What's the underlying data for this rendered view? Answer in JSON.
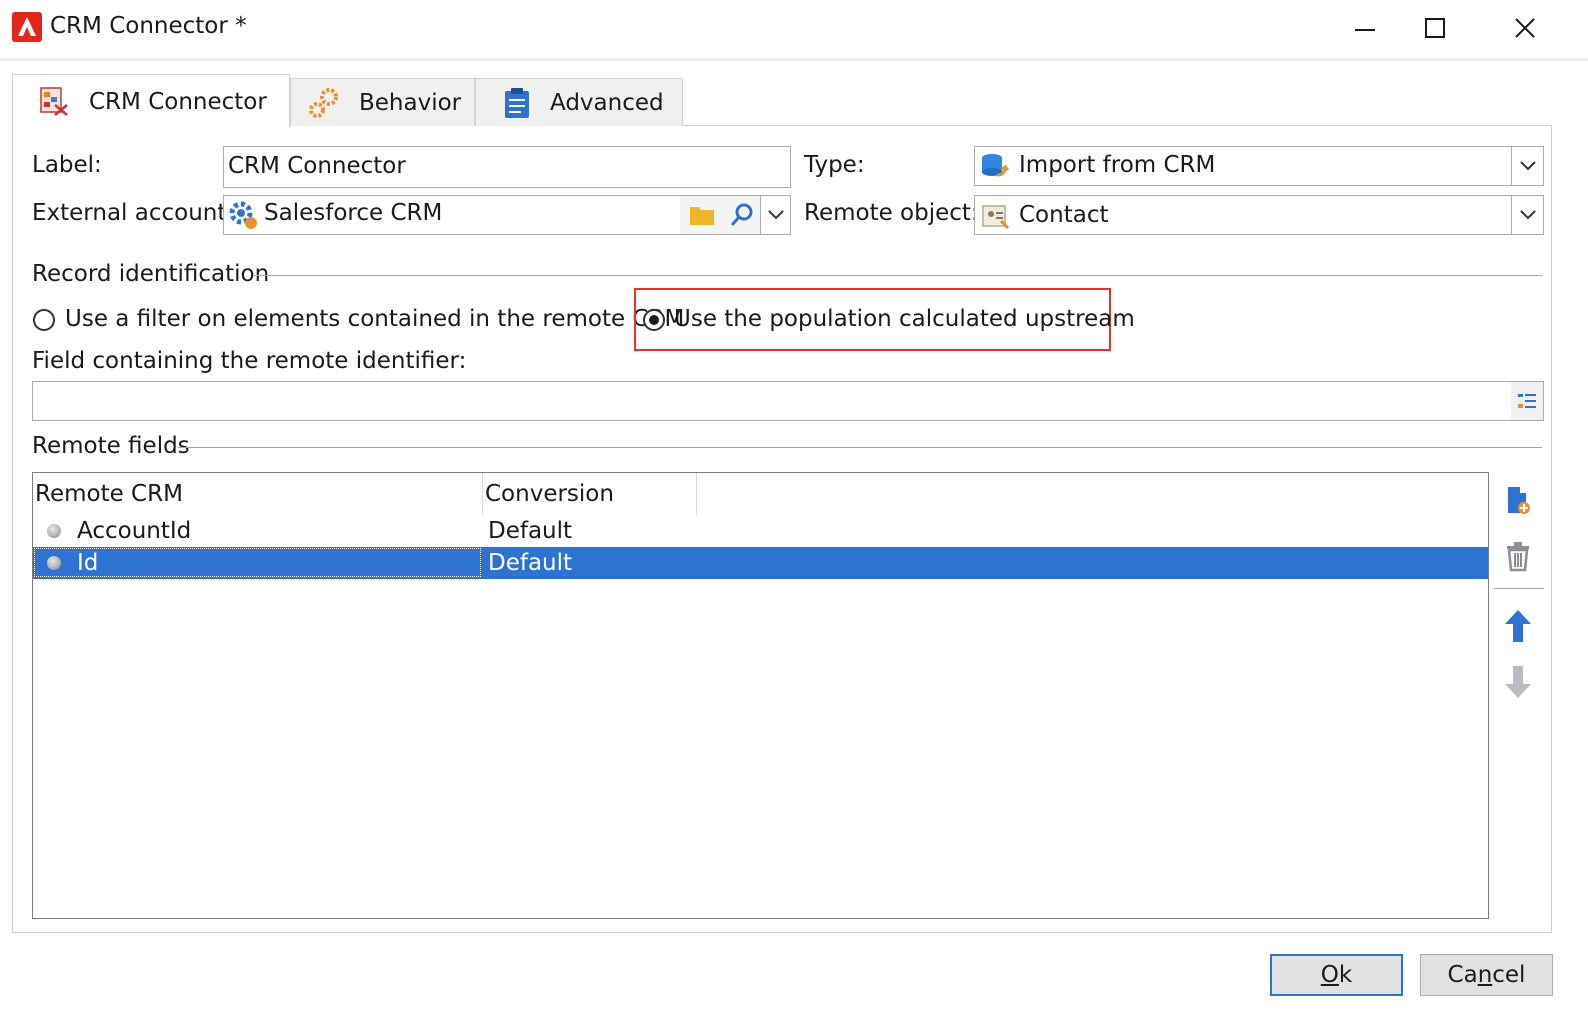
{
  "window": {
    "title": "CRM Connector *"
  },
  "tabs": [
    {
      "label": "CRM Connector",
      "icon": "crm-connector-icon",
      "active": true
    },
    {
      "label": "Behavior",
      "icon": "gears-icon",
      "active": false
    },
    {
      "label": "Advanced",
      "icon": "clipboard-icon",
      "active": false
    }
  ],
  "form": {
    "label_caption": "Label:",
    "label_value": "CRM Connector",
    "type_caption": "Type:",
    "type_value": "Import from CRM",
    "external_account_caption": "External account:",
    "external_account_value": "Salesforce CRM",
    "remote_object_caption": "Remote object:",
    "remote_object_value": "Contact"
  },
  "record_identification": {
    "section_title": "Record identification",
    "option_filter": "Use a filter on elements contained in the remote CRM",
    "option_population": "Use the population calculated upstream",
    "selected": "population",
    "field_caption": "Field containing the remote identifier:",
    "field_value": ""
  },
  "remote_fields": {
    "section_title": "Remote fields",
    "columns": [
      "Remote CRM",
      "Conversion"
    ],
    "rows": [
      {
        "remote": "AccountId",
        "conversion": "Default",
        "selected": false
      },
      {
        "remote": "Id",
        "conversion": "Default",
        "selected": true
      }
    ]
  },
  "buttons": {
    "ok_prefix": "",
    "ok_underlined": "O",
    "ok_rest": "k",
    "cancel_prefix": "Ca",
    "cancel_underlined": "n",
    "cancel_rest": "cel"
  },
  "colors": {
    "selection": "#2e73d2",
    "highlight_border": "#e0382d",
    "brand": "#e3261a"
  }
}
